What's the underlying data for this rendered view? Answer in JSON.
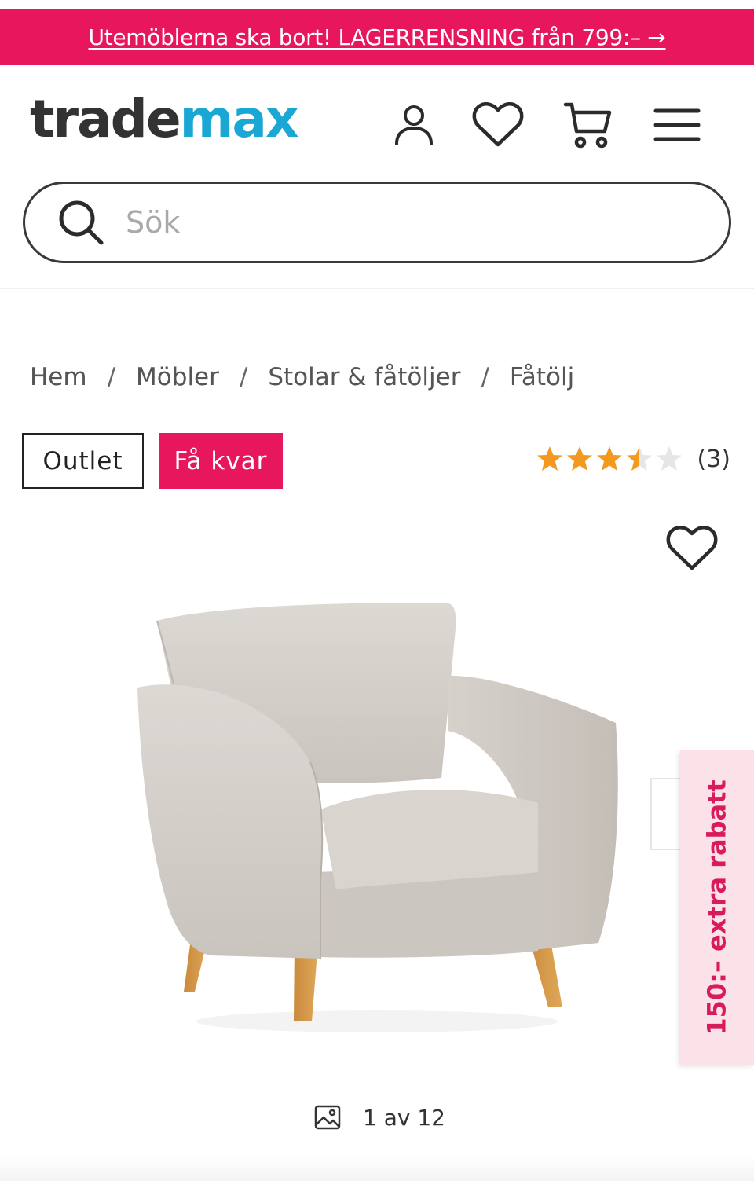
{
  "promo": {
    "text": "Utemöblerna ska bort! LAGERRENSNING från 799:– →"
  },
  "header": {
    "logo_part1": "trade",
    "logo_part2": "max",
    "icons": [
      "user-icon",
      "heart-icon",
      "cart-icon",
      "menu-icon"
    ]
  },
  "search": {
    "placeholder": "Sök",
    "value": ""
  },
  "breadcrumb": {
    "items": [
      "Hem",
      "Möbler",
      "Stolar & fåtöljer",
      "Fåtölj"
    ],
    "separator": "/"
  },
  "badges": {
    "outlet": "Outlet",
    "low_stock": "Få kvar"
  },
  "rating": {
    "stars": 3.5,
    "max": 5,
    "count": "(3)"
  },
  "gallery": {
    "counter": "1 av 12"
  },
  "side_promo": {
    "text": "150:– extra rabatt"
  },
  "colors": {
    "brand_pink": "#e8175d",
    "logo_dark": "#333333",
    "logo_blue": "#1ba7d4",
    "star_orange": "#f39a1e",
    "star_empty": "#e6e6e6",
    "side_tab_bg": "#fbe1e8"
  }
}
